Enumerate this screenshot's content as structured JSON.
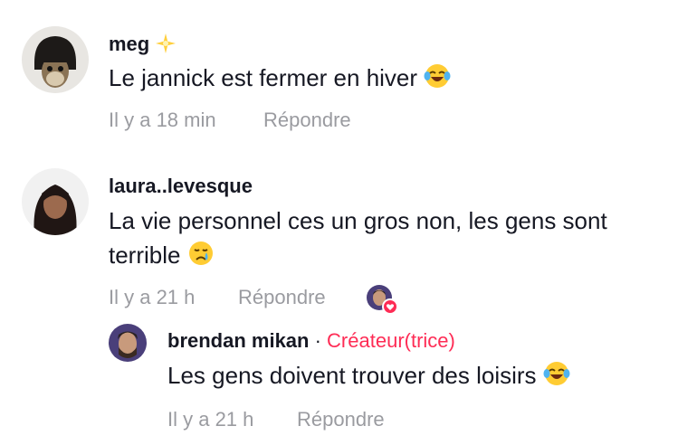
{
  "comments": [
    {
      "username": "meg",
      "text": "Le jannick est fermer en hiver",
      "time": "Il y a 18 min",
      "reply_label": "Répondre"
    },
    {
      "username": "laura..levesque",
      "text_line1": "La vie personnel ces un gros non, les gens sont",
      "text_line2": "terrible",
      "time": "Il y a 21 h",
      "reply_label": "Répondre"
    }
  ],
  "reply": {
    "username": "brendan mikan",
    "separator": " · ",
    "role": "Créateur(trice)",
    "text": "Les gens doivent trouver des loisirs",
    "time": "Il y a 21 h",
    "reply_label": "Répondre"
  },
  "colors": {
    "accent": "#fe2c55",
    "secondary_text": "#9a9ba0",
    "primary_text": "#161823"
  },
  "icons": [
    "star-sparkle-icon",
    "laughing-tears-emoji",
    "crying-face-emoji",
    "creator-liked-heart-icon"
  ]
}
